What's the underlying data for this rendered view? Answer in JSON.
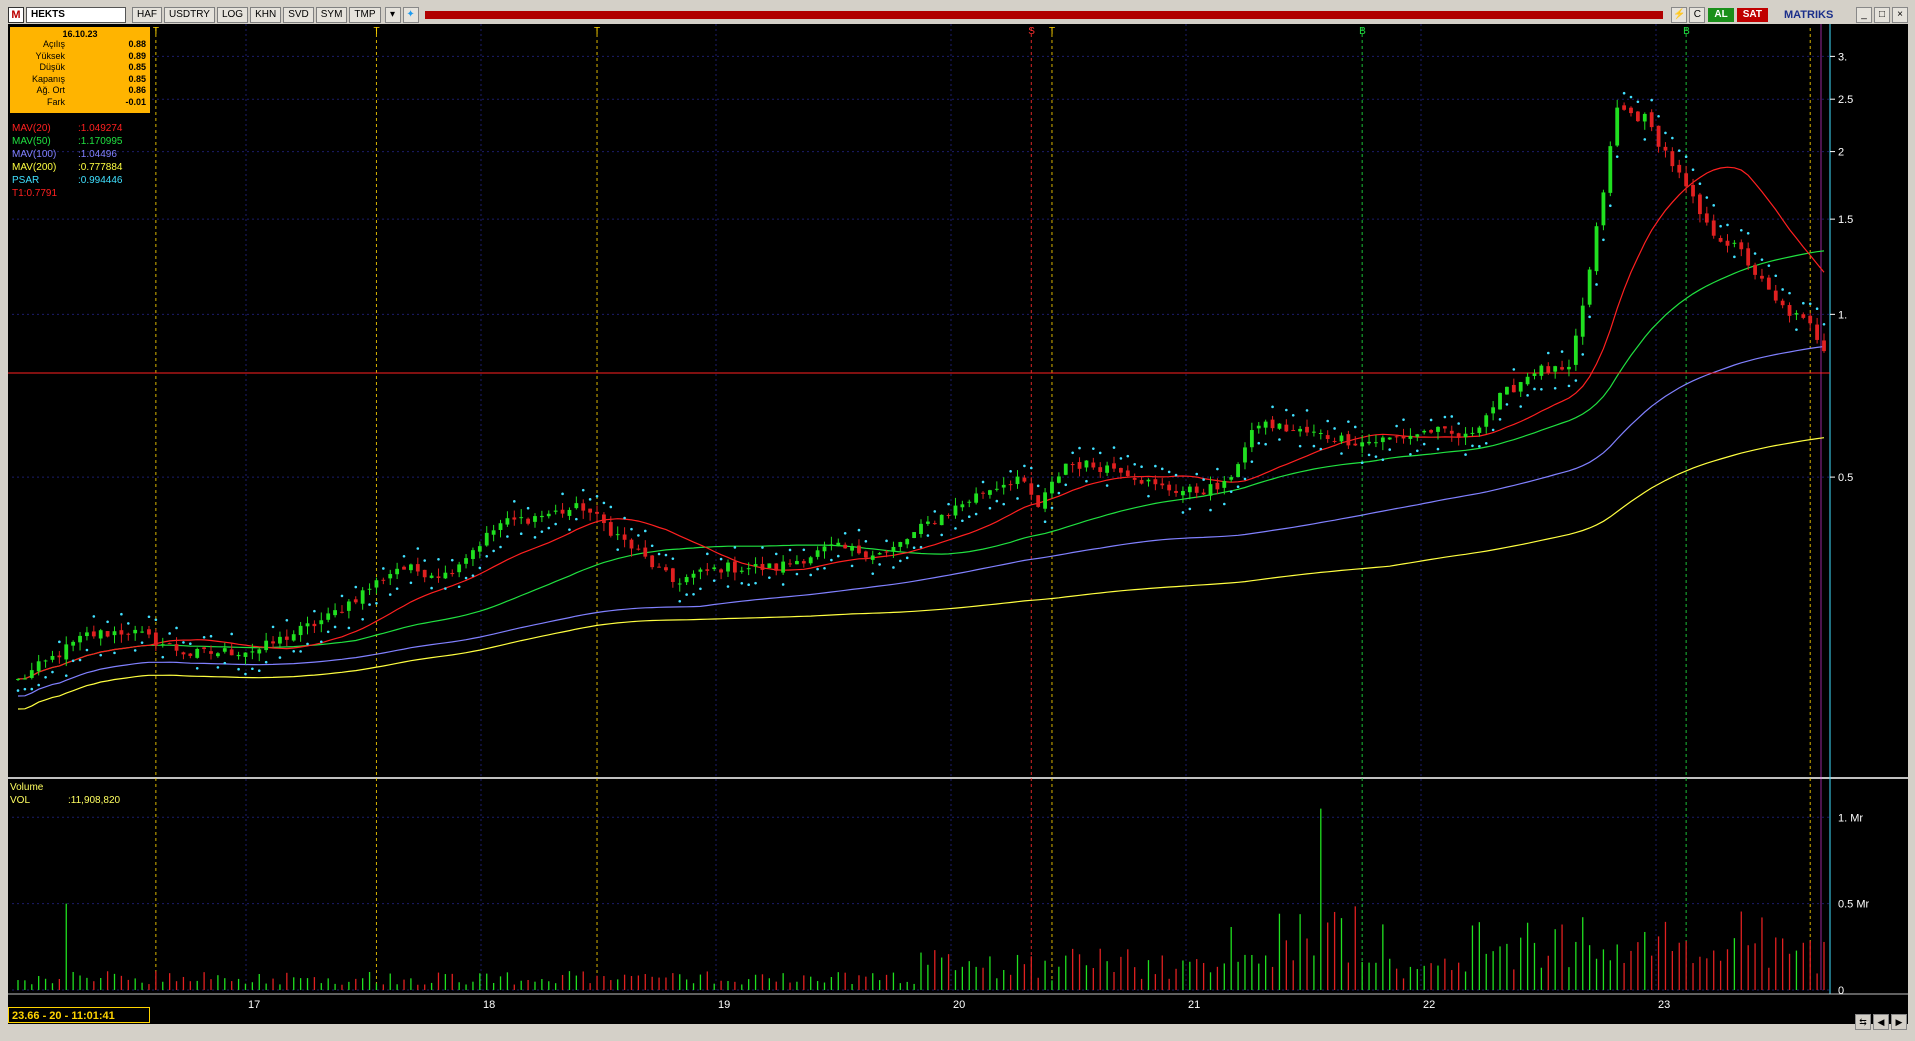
{
  "toolbar": {
    "logo": "M",
    "symbol": "HEKTS",
    "buttons": [
      "HAF",
      "USDTRY",
      "LOG",
      "KHN",
      "SVD",
      "SYM",
      "TMP"
    ],
    "al": "AL",
    "sat": "SAT",
    "brand": "MATRIKS"
  },
  "info": {
    "date": "16.10.23",
    "rows": [
      {
        "k": "Açılış",
        "v": "0.88"
      },
      {
        "k": "Yüksek",
        "v": "0.89"
      },
      {
        "k": "Düşük",
        "v": "0.85"
      },
      {
        "k": "Kapanış",
        "v": "0.85"
      },
      {
        "k": "Ağ. Ort",
        "v": "0.86"
      },
      {
        "k": "Fark",
        "v": "-0.01"
      }
    ]
  },
  "indicators": [
    {
      "label": "MAV(20)",
      "value": ":1.049274",
      "color": "#ff2020"
    },
    {
      "label": "MAV(50)",
      "value": ":1.170995",
      "color": "#20e040"
    },
    {
      "label": "MAV(100)",
      "value": ":1.04496",
      "color": "#8080ff"
    },
    {
      "label": "MAV(200)",
      "value": ":0.777884",
      "color": "#ffff40"
    },
    {
      "label": "PSAR",
      "value": ":0.994446",
      "color": "#40e0ff"
    },
    {
      "label": "T1:0.7791",
      "value": "",
      "color": "#ff2020"
    }
  ],
  "volume_panel": {
    "title": "Volume",
    "label": "VOL",
    "value": ":11,908,820"
  },
  "status": {
    "text": "23.66 - 20 - 11:01:41"
  },
  "colors": {
    "up": "#20e020",
    "down": "#e02020",
    "grid": "#1c1c6a",
    "axis": "#ffffff"
  },
  "chart_data": {
    "type": "candlestick",
    "scale": "log",
    "price_axis": {
      "ticks": [
        3,
        2.5,
        2,
        1.5,
        1,
        0.5
      ],
      "tick_labels": [
        "3.",
        "2.5",
        "2",
        "1.5",
        "1.",
        "0.5"
      ],
      "ylim": [
        0.14,
        3.3
      ]
    },
    "volume_axis": {
      "tick_labels": [
        "1. Mr",
        "0.5 Mr",
        "0"
      ],
      "ticks": [
        1,
        0.5,
        0
      ],
      "ylim": [
        0,
        1.1
      ]
    },
    "x_tick_labels": [
      "17",
      "18",
      "19",
      "20",
      "21",
      "22",
      "23"
    ],
    "horizontal_line": {
      "value": 0.7791,
      "label": "T1:0.7791"
    },
    "signals": [
      {
        "label": "T",
        "idx": 20
      },
      {
        "label": "T",
        "idx": 52
      },
      {
        "label": "T",
        "idx": 84
      },
      {
        "label": "S",
        "idx": 147
      },
      {
        "label": "T",
        "idx": 150
      },
      {
        "label": "B",
        "idx": 195
      },
      {
        "label": "B",
        "idx": 242
      },
      {
        "label": "",
        "idx": 260
      }
    ],
    "anchors": [
      [
        0,
        0.21
      ],
      [
        10,
        0.255
      ],
      [
        16,
        0.26
      ],
      [
        25,
        0.235
      ],
      [
        35,
        0.24
      ],
      [
        45,
        0.275
      ],
      [
        55,
        0.34
      ],
      [
        62,
        0.33
      ],
      [
        70,
        0.41
      ],
      [
        78,
        0.43
      ],
      [
        82,
        0.44
      ],
      [
        88,
        0.38
      ],
      [
        95,
        0.32
      ],
      [
        102,
        0.34
      ],
      [
        110,
        0.34
      ],
      [
        118,
        0.37
      ],
      [
        126,
        0.36
      ],
      [
        132,
        0.41
      ],
      [
        140,
        0.47
      ],
      [
        145,
        0.5
      ],
      [
        148,
        0.44
      ],
      [
        152,
        0.53
      ],
      [
        160,
        0.52
      ],
      [
        165,
        0.48
      ],
      [
        170,
        0.47
      ],
      [
        175,
        0.48
      ],
      [
        180,
        0.63
      ],
      [
        185,
        0.61
      ],
      [
        195,
        0.58
      ],
      [
        200,
        0.59
      ],
      [
        205,
        0.61
      ],
      [
        210,
        0.59
      ],
      [
        215,
        0.7
      ],
      [
        220,
        0.79
      ],
      [
        225,
        0.78
      ],
      [
        228,
        1.2
      ],
      [
        232,
        2.4
      ],
      [
        236,
        2.3
      ],
      [
        240,
        1.9
      ],
      [
        245,
        1.45
      ],
      [
        250,
        1.3
      ],
      [
        255,
        1.05
      ],
      [
        260,
        0.95
      ],
      [
        262,
        0.87
      ]
    ],
    "n_bars": 263
  }
}
